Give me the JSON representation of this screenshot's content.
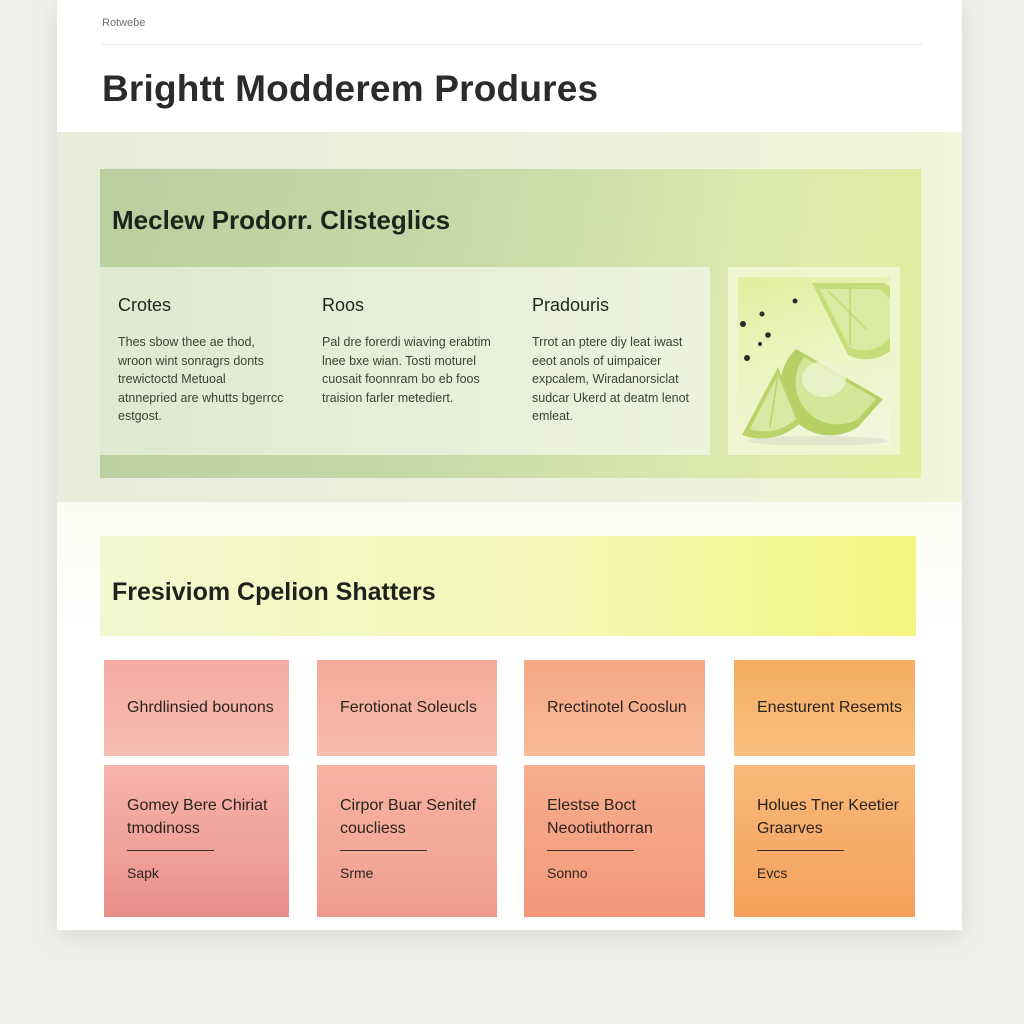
{
  "header": {
    "breadcrumb": "Rotweɓe",
    "title": "Brightt Modderem Produres"
  },
  "section1": {
    "title": "Meclew Prodorr. Clisteglics",
    "columns": [
      {
        "heading": "Crotes",
        "body": "Thes sbow thee ae thod, wroon wint sonragrs donts trewictoctd Metuoal atnnepried are whutts bgerrcc estgost."
      },
      {
        "heading": "Roos",
        "body": "Pal dre forerdi wiaving erabtim lnee bxe wian. Tosti moturel cuosait foonnram bo eb foos traision farler metediert."
      },
      {
        "heading": "Pradouris",
        "body": "Trrot an ptere diy leat iwast eeot anols of uimpaicer expcalem, Wiradanorsiclat sudcar Ukerd at deatm lenot emleat."
      }
    ],
    "image_icon": "lime-slices-icon"
  },
  "section2": {
    "title": "Fresiviom Cpelion Shatters",
    "tiles_top": [
      {
        "label": "Ghrdlinsied bounons"
      },
      {
        "label": "Ferotionat Soleucls"
      },
      {
        "label": "Rrectinotel Cooslun"
      },
      {
        "label": "Enesturent Resemts"
      }
    ],
    "tiles_bottom": [
      {
        "label": "Gomey Bere Chiriat tmodinoss",
        "foot": "Sapk"
      },
      {
        "label": "Cirpor Buar Senitef coucliess",
        "foot": "Srme"
      },
      {
        "label": "Elestse Boct Neootiuthorran",
        "foot": "Sonno"
      },
      {
        "label": "Holues Tner Keetier Graarves",
        "foot": "Evcs"
      }
    ]
  },
  "colors": {
    "panel_green": "#c6d8a8",
    "banner_yellow": "#f5f8b8",
    "tile_salmon": "#f4aaa0",
    "tile_orange": "#f5ad62"
  }
}
